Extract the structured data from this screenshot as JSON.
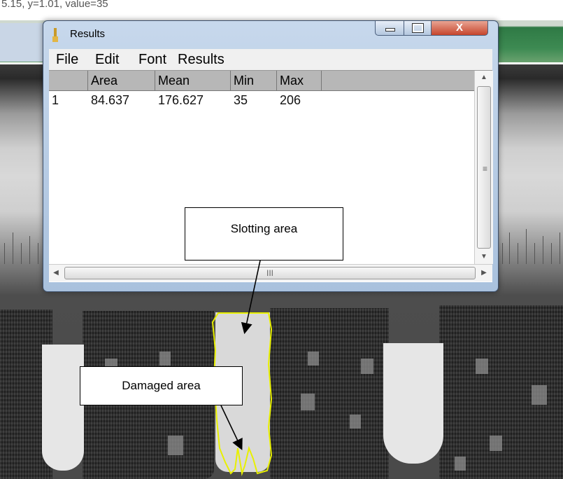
{
  "status_line": "5.15, y=1.01, value=35",
  "window": {
    "title": "Results",
    "controls": {
      "minimize": "minimize",
      "maximize": "maximize",
      "close": "X"
    }
  },
  "menu": [
    "File",
    "Edit",
    "Font",
    "Results"
  ],
  "table": {
    "columns": [
      "",
      "Area",
      "Mean",
      "Min",
      "Max"
    ],
    "rows": [
      [
        "1",
        "84.637",
        "176.627",
        "35",
        "206"
      ]
    ]
  },
  "scrollbar_grip": "≡",
  "hscroll_grip": "III",
  "annotations": {
    "slotting": "Slotting area",
    "damaged": "Damaged area"
  },
  "colors": {
    "selection_outline": "#e8f000",
    "close_button": "#c6452c",
    "header_bg": "#b7b7b7"
  }
}
